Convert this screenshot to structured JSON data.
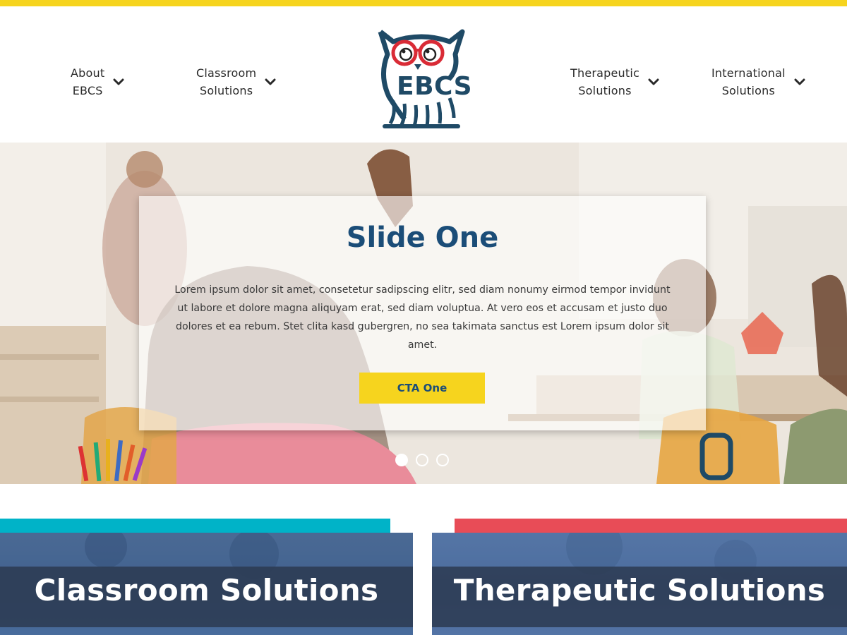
{
  "colors": {
    "accent_yellow": "#f6d41e",
    "brand_navy": "#1b4d78",
    "logo_red": "#d92b36",
    "teal": "#00b3c8",
    "coral": "#e84c57"
  },
  "logo": {
    "text": "EBCS",
    "icon": "owl-with-glasses-icon"
  },
  "nav": {
    "left": [
      {
        "line1": "About",
        "line2": "EBCS"
      },
      {
        "line1": "Classroom",
        "line2": "Solutions"
      }
    ],
    "right": [
      {
        "line1": "Therapeutic",
        "line2": "Solutions"
      },
      {
        "line1": "International",
        "line2": "Solutions"
      }
    ],
    "chevron_icon": "chevron-down-icon"
  },
  "hero": {
    "title": "Slide One",
    "body": "Lorem ipsum dolor sit amet, consetetur sadipscing elitr, sed diam nonumy eirmod tempor invidunt ut labore et dolore magna aliquyam erat, sed diam voluptua. At vero eos et accusam et justo duo dolores et ea rebum. Stet clita kasd gubergren, no sea takimata sanctus est Lorem ipsum dolor sit amet.",
    "cta": "CTA One",
    "slides_total": 3,
    "active_slide": 1
  },
  "cards": [
    {
      "title": "Classroom Solutions"
    },
    {
      "title": "Therapeutic Solutions"
    }
  ]
}
